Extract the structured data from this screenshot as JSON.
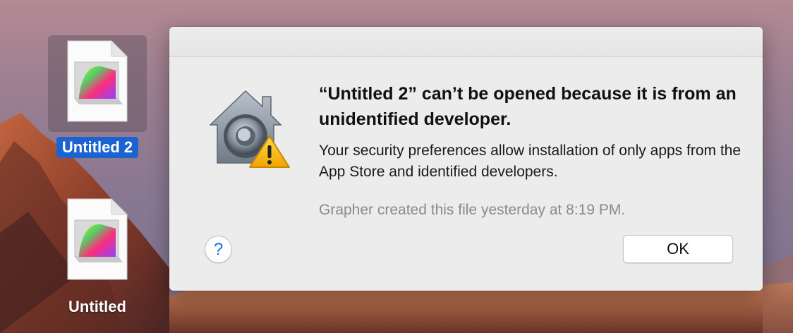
{
  "desktop": {
    "icons": [
      {
        "label": "Untitled 2",
        "selected": true
      },
      {
        "label": "Untitled",
        "selected": false
      }
    ]
  },
  "dialog": {
    "heading": "“Untitled 2” can’t be opened because it is from an unidentified developer.",
    "message": "Your security preferences allow installation of only apps from the App Store and identified developers.",
    "info": "Grapher created this file yesterday at 8:19 PM.",
    "help_label": "?",
    "ok_label": "OK",
    "icon": "gatekeeper-security-warning-icon"
  },
  "colors": {
    "selection_blue": "#1c63d2",
    "dialog_bg": "#ececec",
    "help_blue": "#1d6fe0"
  }
}
